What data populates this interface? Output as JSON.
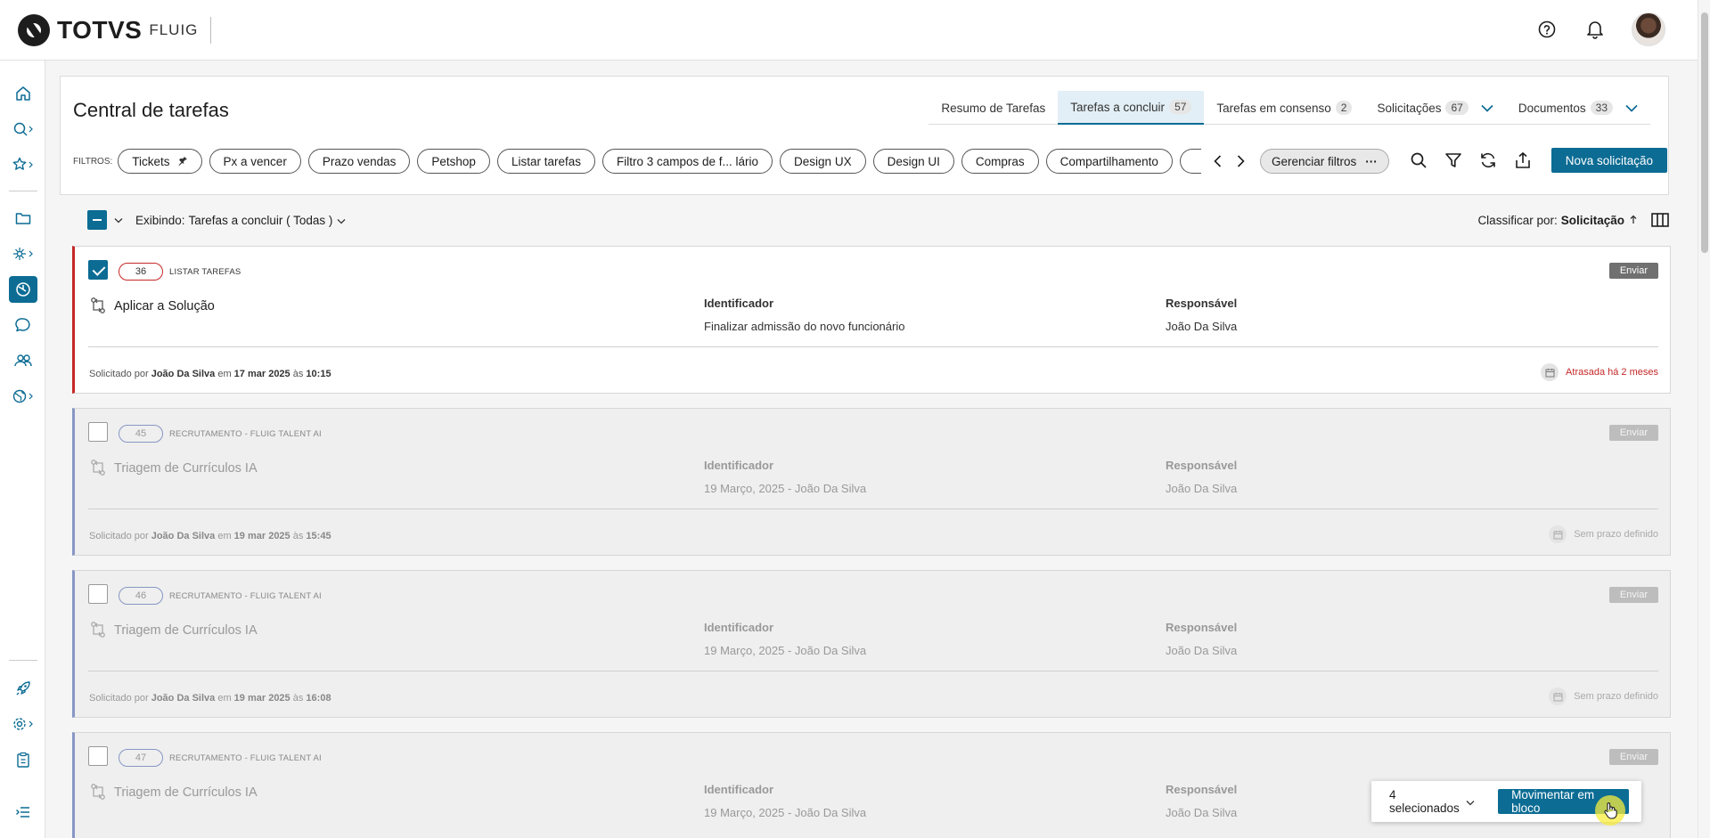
{
  "brand": {
    "name": "TOTVS",
    "product": "FLUIG"
  },
  "page_title": "Central de tarefas",
  "tabs": [
    {
      "label": "Resumo de Tarefas",
      "count": ""
    },
    {
      "label": "Tarefas a concluir",
      "count": "57"
    },
    {
      "label": "Tarefas em consenso",
      "count": "2"
    },
    {
      "label": "Solicitações",
      "count": "67"
    },
    {
      "label": "Documentos",
      "count": "33"
    }
  ],
  "filters": {
    "label": "FILTROS:",
    "chips": [
      "Tickets",
      "Px a vencer",
      "Prazo vendas",
      "Petshop",
      "Listar tarefas",
      "Filtro 3 campos de f... lário",
      "Design UX",
      "Design UI",
      "Compras",
      "Compartilhamento"
    ],
    "manage_label": "Gerenciar filtros",
    "manage_more": "···"
  },
  "actions": {
    "new_request": "Nova solicitação"
  },
  "list": {
    "showing_label": "Exibindo:",
    "showing_value": "Tarefas a concluir ( Todas )",
    "sort_label": "Classificar por:",
    "sort_value": "Solicitação"
  },
  "cards": [
    {
      "number": "36",
      "process": "LISTAR TAREFAS",
      "send": "Enviar",
      "task": "Aplicar a Solução",
      "id_label": "Identificador",
      "id_value": "Finalizar admissão do novo funcionário",
      "resp_label": "Responsável",
      "resp_value": "João Da Silva",
      "requested_by": "Solicitado por",
      "requester": "João Da Silva",
      "on": "em",
      "date": "17 mar 2025",
      "at": "às",
      "time": "10:15",
      "due": "Atrasada há 2 meses"
    },
    {
      "number": "45",
      "process": "RECRUTAMENTO - FLUIG TALENT AI",
      "send": "Enviar",
      "task": "Triagem de Currículos IA",
      "id_label": "Identificador",
      "id_value": "19 Março, 2025 - João Da Silva",
      "resp_label": "Responsável",
      "resp_value": "João Da Silva",
      "requested_by": "Solicitado por",
      "requester": "João Da Silva",
      "on": "em",
      "date": "19 mar 2025",
      "at": "às",
      "time": "15:45",
      "due": "Sem prazo definido"
    },
    {
      "number": "46",
      "process": "RECRUTAMENTO - FLUIG TALENT AI",
      "send": "Enviar",
      "task": "Triagem de Currículos IA",
      "id_label": "Identificador",
      "id_value": "19 Março, 2025 - João Da Silva",
      "resp_label": "Responsável",
      "resp_value": "João Da Silva",
      "requested_by": "Solicitado por",
      "requester": "João Da Silva",
      "on": "em",
      "date": "19 mar 2025",
      "at": "às",
      "time": "16:08",
      "due": "Sem prazo definido"
    },
    {
      "number": "47",
      "process": "RECRUTAMENTO - FLUIG TALENT AI",
      "send": "Enviar",
      "task": "Triagem de Currículos IA",
      "id_label": "Identificador",
      "id_value": "19 Março, 2025 - João Da Silva",
      "resp_label": "Responsável",
      "resp_value": "João Da Silva"
    }
  ],
  "bulk": {
    "selected": "4 selecionados",
    "move": "Movimentar em bloco"
  },
  "colors": {
    "primary": "#0c6c94",
    "overdue": "#c62828",
    "dim_accent": "#8797c4"
  }
}
